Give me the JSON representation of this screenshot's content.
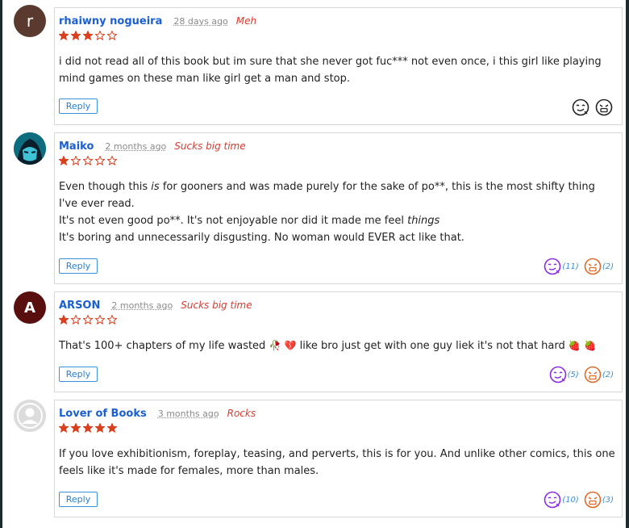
{
  "comments": [
    {
      "avatar": {
        "type": "letter",
        "letter": "r",
        "bg": "#5a3a2e"
      },
      "username": "rhaiwny nogueira",
      "time": "28 days ago",
      "verdict": "Meh",
      "rating": 3,
      "body": [
        "i did not read all of this book but im sure that she never got fuc*** not even once, i this girl like playing mind games on these man like girl get a man and stop."
      ],
      "reply_label": "Reply",
      "reactions": {
        "like": "",
        "dislike": ""
      }
    },
    {
      "avatar": {
        "type": "image",
        "bg": "#0b7a8c"
      },
      "username": "Maiko",
      "time": "2 months ago",
      "verdict": "Sucks big time",
      "rating": 1,
      "body_rich": {
        "l1a": "Even though this ",
        "l1b": "is",
        "l1c": " for gooners and was made purely for the sake of po**, this is the most shifty thing I've ever read.",
        "l2a": "It's not even good po**. It's not enjoyable nor did it made me feel ",
        "l2b": "things",
        ".l2c": ".",
        "l3": "It's boring and unnecessarily disgusting. No woman would EVER act like that."
      },
      "reply_label": "Reply",
      "reactions": {
        "like": "(11)",
        "dislike": "(2)"
      }
    },
    {
      "avatar": {
        "type": "letter",
        "letter": "A",
        "bg": "#5a0f0f"
      },
      "username": "ARSON",
      "time": "2 months ago",
      "verdict": "Sucks big time",
      "rating": 1,
      "body_parts": {
        "a": "That's 100+ chapters of my life wasted ",
        "e1": "🥀",
        "e2": "💔",
        "b": "  like bro just get with one guy liek it's not that hard ",
        "e3": "🍓",
        "e4": "🍓"
      },
      "reply_label": "Reply",
      "reactions": {
        "like": "(5)",
        "dislike": "(2)"
      }
    },
    {
      "avatar": {
        "type": "default",
        "bg": "#d8d8d8"
      },
      "username": "Lover of Books",
      "time": "3 months ago",
      "verdict": "Rocks",
      "rating": 5,
      "body": [
        "If you love exhibitionism, foreplay, teasing, and perverts, this is for you. And unlike other comics, this one feels like it's made for females, more than males."
      ],
      "reply_label": "Reply",
      "reactions": {
        "like": "(10)",
        "dislike": "(3)"
      }
    }
  ],
  "colors": {
    "star": "#d9401f",
    "like": "#8a2be2",
    "dislike": "#e06a2a",
    "link": "#1b5fd1",
    "verdict": "#d93a2e"
  }
}
